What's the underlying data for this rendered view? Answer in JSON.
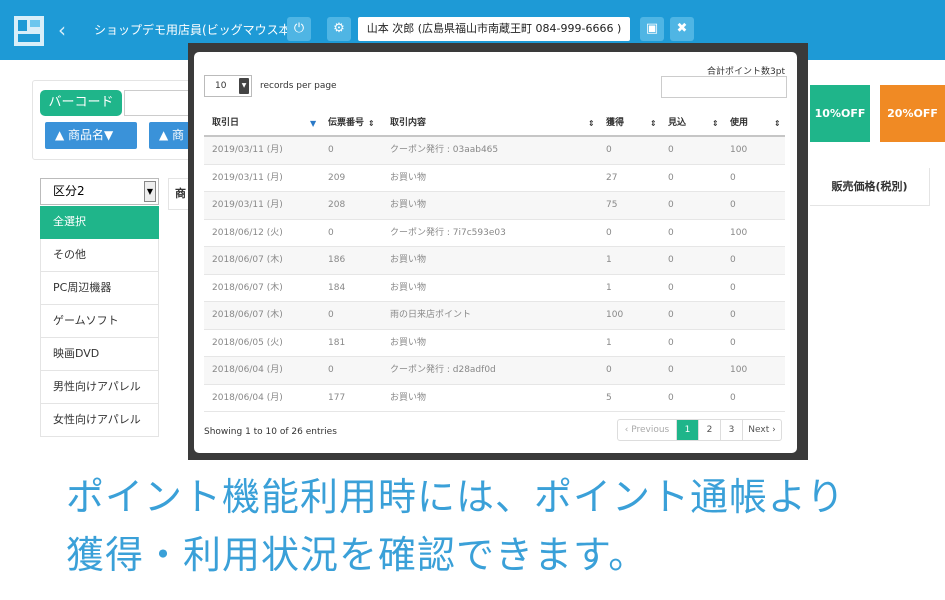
{
  "header": {
    "shop_name": "ショップデモ用店員(ビッグマウス本店)",
    "customer_info": "山本 次郎 (広島県福山市南蔵王町 084-999-6666 )",
    "back_glyph": "‹",
    "icons": {
      "power": "⏻",
      "settings": "⚙",
      "document": "▣",
      "close": "✖"
    }
  },
  "background": {
    "barcode_label": "バーコード",
    "sort_buttons": [
      "▲ 商品名▼",
      "▲ 商"
    ],
    "category_select": "区分2",
    "categories": [
      "全選択",
      "その他",
      "PC周辺機器",
      "ゲームソフト",
      "映画DVD",
      "男性向けアパレル",
      "女性向けアパレル"
    ],
    "product_header_fragment": "商",
    "price_header": "販売価格(税別)",
    "discounts": [
      {
        "label": "10%OFF",
        "color": "#1fb58a"
      },
      {
        "label": "20%OFF",
        "color": "#f08a24"
      }
    ]
  },
  "modal": {
    "total_points": "合計ポイント数3pt",
    "page_size": "10",
    "records_label": "records per page",
    "columns": [
      "取引日",
      "伝票番号",
      "取引内容",
      "獲得",
      "見込",
      "使用"
    ],
    "rows": [
      [
        "2019/03/11 (月)",
        "0",
        "クーポン発行 : 03aab465",
        "0",
        "0",
        "100"
      ],
      [
        "2019/03/11 (月)",
        "209",
        "お買い物",
        "27",
        "0",
        "0"
      ],
      [
        "2019/03/11 (月)",
        "208",
        "お買い物",
        "75",
        "0",
        "0"
      ],
      [
        "2018/06/12 (火)",
        "0",
        "クーポン発行 : 7i7c593e03",
        "0",
        "0",
        "100"
      ],
      [
        "2018/06/07 (木)",
        "186",
        "お買い物",
        "1",
        "0",
        "0"
      ],
      [
        "2018/06/07 (木)",
        "184",
        "お買い物",
        "1",
        "0",
        "0"
      ],
      [
        "2018/06/07 (木)",
        "0",
        "雨の日来店ポイント",
        "100",
        "0",
        "0"
      ],
      [
        "2018/06/05 (火)",
        "181",
        "お買い物",
        "1",
        "0",
        "0"
      ],
      [
        "2018/06/04 (月)",
        "0",
        "クーポン発行 : d28adf0d",
        "0",
        "0",
        "100"
      ],
      [
        "2018/06/04 (月)",
        "177",
        "お買い物",
        "5",
        "0",
        "0"
      ]
    ],
    "showing": "Showing 1 to 10 of 26 entries",
    "pagination": {
      "prev": "‹ Previous",
      "pages": [
        "1",
        "2",
        "3"
      ],
      "next": "Next ›"
    }
  },
  "caption": {
    "line1": "ポイント機能利用時には、ポイント通帳より",
    "line2": "獲得・利用状況を確認できます。"
  }
}
